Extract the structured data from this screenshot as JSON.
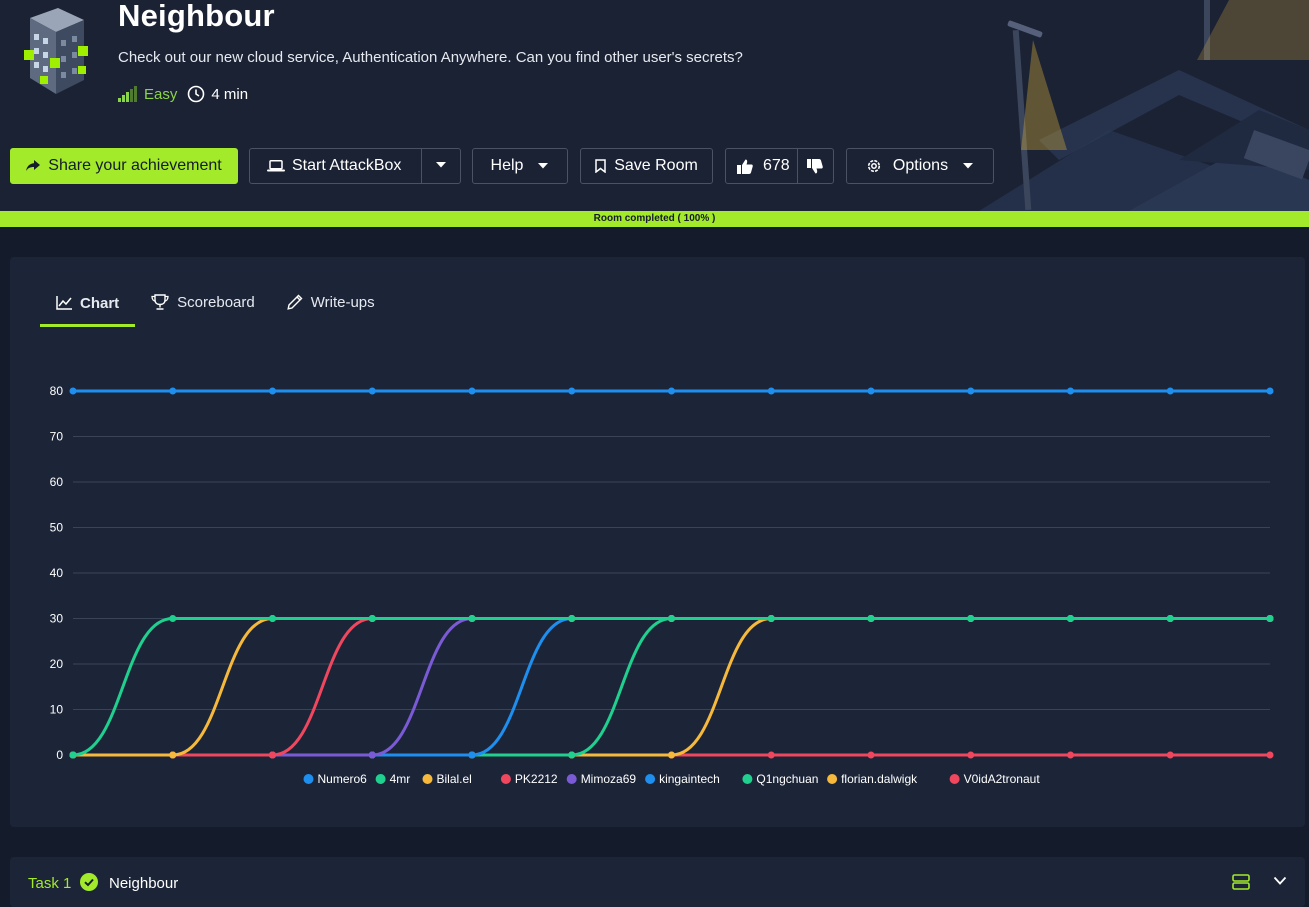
{
  "room": {
    "title": "Neighbour",
    "description": "Check out our new cloud service, Authentication Anywhere. Can you find other user's secrets?",
    "difficulty": "Easy",
    "duration": "4 min"
  },
  "toolbar": {
    "share_label": "Share your achievement",
    "attackbox_label": "Start AttackBox",
    "help_label": "Help",
    "save_label": "Save Room",
    "likes": "678",
    "options_label": "Options"
  },
  "progress": {
    "label": "Room completed ( 100% )",
    "value": 1.0
  },
  "tabs": [
    {
      "label": "Chart",
      "icon": "line-chart-icon",
      "active": true
    },
    {
      "label": "Scoreboard",
      "icon": "trophy-icon",
      "active": false
    },
    {
      "label": "Write-ups",
      "icon": "pencil-icon",
      "active": false
    }
  ],
  "chart_data": {
    "type": "line",
    "title": "",
    "xlabel": "",
    "ylabel": "",
    "ylim": [
      0,
      80
    ],
    "yticks": [
      0,
      10,
      20,
      30,
      40,
      50,
      60,
      70,
      80
    ],
    "grid": true,
    "legend_position": "bottom",
    "x": [
      1,
      2,
      3,
      4,
      5,
      6,
      7,
      8,
      9,
      10,
      11,
      12,
      13
    ],
    "series": [
      {
        "name": "Numero6",
        "color": "#1e8fee",
        "values": [
          80,
          80,
          80,
          80,
          80,
          80,
          80,
          80,
          80,
          80,
          80,
          80,
          80
        ]
      },
      {
        "name": "4mr",
        "color": "#1fd08e",
        "values": [
          0,
          30,
          30,
          30,
          30,
          30,
          30,
          30,
          30,
          30,
          30,
          30,
          30
        ]
      },
      {
        "name": "Bilal.el",
        "color": "#f6b93b",
        "values": [
          0,
          0,
          30,
          30,
          30,
          30,
          30,
          30,
          30,
          30,
          30,
          30,
          30
        ]
      },
      {
        "name": "PK2212",
        "color": "#f0475e",
        "values": [
          0,
          0,
          0,
          30,
          30,
          30,
          30,
          30,
          30,
          30,
          30,
          30,
          30
        ]
      },
      {
        "name": "Mimoza69",
        "color": "#7b5ad6",
        "values": [
          0,
          0,
          0,
          0,
          30,
          30,
          30,
          30,
          30,
          30,
          30,
          30,
          30
        ]
      },
      {
        "name": "kingaintech",
        "color": "#1e8fee",
        "values": [
          0,
          0,
          0,
          0,
          0,
          30,
          30,
          30,
          30,
          30,
          30,
          30,
          30
        ]
      },
      {
        "name": "Q1ngchuan",
        "color": "#1fd08e",
        "values": [
          0,
          0,
          0,
          0,
          0,
          0,
          30,
          30,
          30,
          30,
          30,
          30,
          30
        ]
      },
      {
        "name": "florian.dalwigk",
        "color": "#f6b93b",
        "values": [
          0,
          0,
          0,
          0,
          0,
          0,
          0,
          30,
          30,
          30,
          30,
          30,
          30
        ]
      },
      {
        "name": "V0idA2tronaut",
        "color": "#f0475e",
        "values": [
          0,
          0,
          0,
          0,
          0,
          0,
          0,
          0,
          0,
          0,
          0,
          0,
          0
        ]
      }
    ]
  },
  "task": {
    "label": "Task 1",
    "name": "Neighbour"
  },
  "colors": {
    "accent": "#a3ea2a",
    "background": "#141c2b",
    "card": "#1c2538"
  }
}
